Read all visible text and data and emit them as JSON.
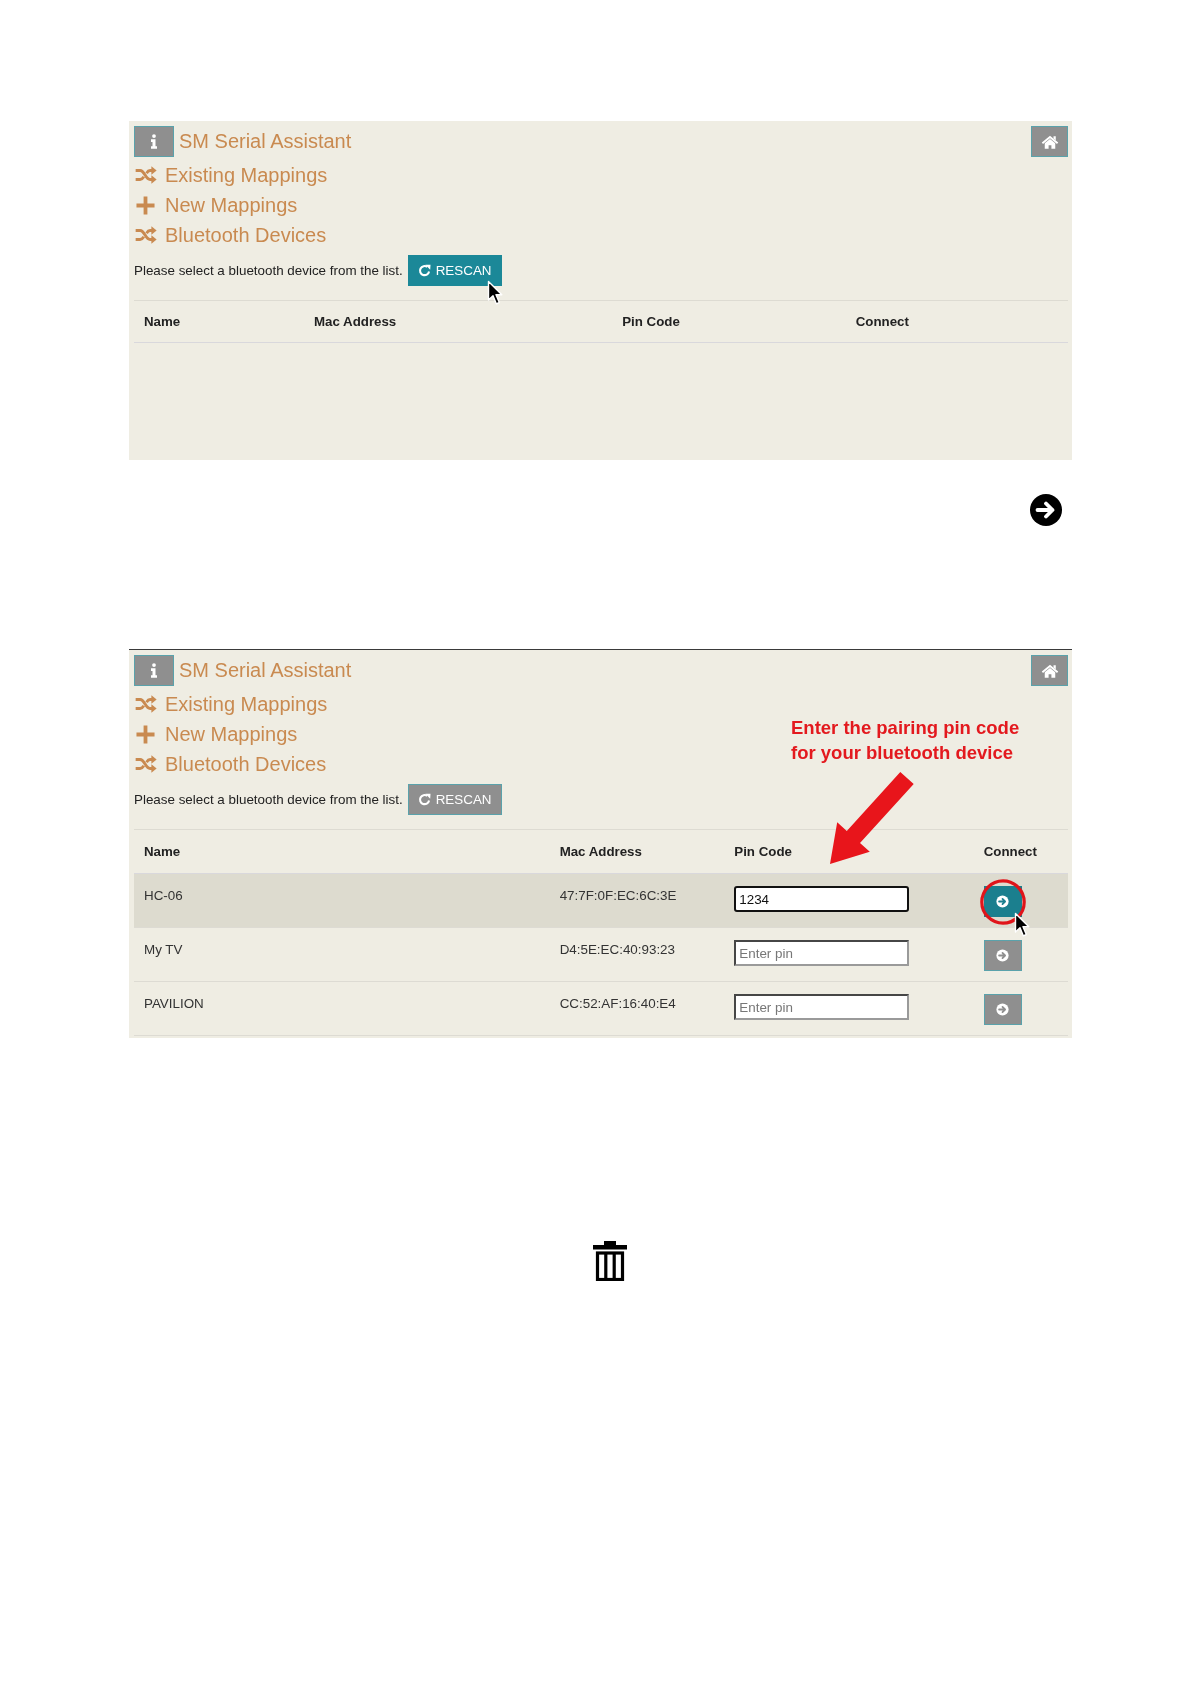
{
  "screens": [
    {
      "header": {
        "title": "SM Serial Assistant"
      },
      "nav": [
        {
          "kind": "shuffle",
          "label": "Existing Mappings"
        },
        {
          "kind": "plus",
          "label": "New Mappings"
        },
        {
          "kind": "shuffle",
          "label": "Bluetooth Devices"
        }
      ],
      "prompt": "Please select a bluetooth device from the list.",
      "rescan_button": {
        "label": "RESCAN",
        "hovered": true
      },
      "table": {
        "columns": [
          "Name",
          "Mac Address",
          "Pin Code",
          "Connect"
        ]
      }
    },
    {
      "header": {
        "title": "SM Serial Assistant"
      },
      "nav": [
        {
          "kind": "shuffle",
          "label": "Existing Mappings"
        },
        {
          "kind": "plus",
          "label": "New Mappings"
        },
        {
          "kind": "shuffle",
          "label": "Bluetooth Devices"
        }
      ],
      "prompt": "Please select a bluetooth device from the list.",
      "rescan_button": {
        "label": "RESCAN",
        "hovered": false
      },
      "annotation": {
        "text": "Enter the pairing pin code\nfor your bluetooth device"
      },
      "table": {
        "columns": [
          "Name",
          "Mac Address",
          "Pin Code",
          "Connect"
        ],
        "rows": [
          {
            "name": "HC-06",
            "mac_address": "47:7F:0F:EC:6C:3E",
            "pin": {
              "value": "1234",
              "focused": true
            },
            "highlighted": true,
            "connect_hovered": true,
            "circled": true
          },
          {
            "name": "My TV",
            "mac_address": "D4:5E:EC:40:93:23",
            "pin": {
              "placeholder": "Enter pin",
              "focused": false
            },
            "highlighted": false,
            "connect_hovered": false,
            "circled": false
          },
          {
            "name": "PAVILION",
            "mac_address": "CC:52:AF:16:40:E4",
            "pin": {
              "placeholder": "Enter pin",
              "focused": false
            },
            "highlighted": false,
            "connect_hovered": false,
            "circled": false
          }
        ]
      }
    }
  ]
}
